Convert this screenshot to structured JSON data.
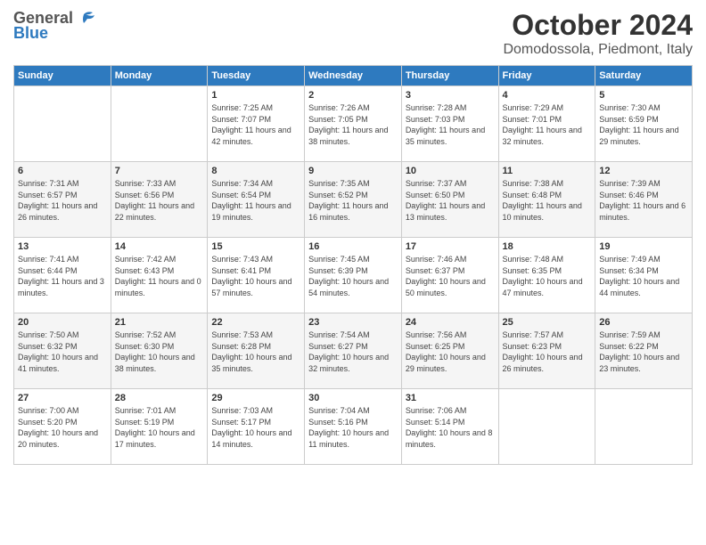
{
  "header": {
    "logo_general": "General",
    "logo_blue": "Blue",
    "month": "October 2024",
    "location": "Domodossola, Piedmont, Italy"
  },
  "weekdays": [
    "Sunday",
    "Monday",
    "Tuesday",
    "Wednesday",
    "Thursday",
    "Friday",
    "Saturday"
  ],
  "weeks": [
    [
      {
        "day": "",
        "info": ""
      },
      {
        "day": "",
        "info": ""
      },
      {
        "day": "1",
        "info": "Sunrise: 7:25 AM\nSunset: 7:07 PM\nDaylight: 11 hours and 42 minutes."
      },
      {
        "day": "2",
        "info": "Sunrise: 7:26 AM\nSunset: 7:05 PM\nDaylight: 11 hours and 38 minutes."
      },
      {
        "day": "3",
        "info": "Sunrise: 7:28 AM\nSunset: 7:03 PM\nDaylight: 11 hours and 35 minutes."
      },
      {
        "day": "4",
        "info": "Sunrise: 7:29 AM\nSunset: 7:01 PM\nDaylight: 11 hours and 32 minutes."
      },
      {
        "day": "5",
        "info": "Sunrise: 7:30 AM\nSunset: 6:59 PM\nDaylight: 11 hours and 29 minutes."
      }
    ],
    [
      {
        "day": "6",
        "info": "Sunrise: 7:31 AM\nSunset: 6:57 PM\nDaylight: 11 hours and 26 minutes."
      },
      {
        "day": "7",
        "info": "Sunrise: 7:33 AM\nSunset: 6:56 PM\nDaylight: 11 hours and 22 minutes."
      },
      {
        "day": "8",
        "info": "Sunrise: 7:34 AM\nSunset: 6:54 PM\nDaylight: 11 hours and 19 minutes."
      },
      {
        "day": "9",
        "info": "Sunrise: 7:35 AM\nSunset: 6:52 PM\nDaylight: 11 hours and 16 minutes."
      },
      {
        "day": "10",
        "info": "Sunrise: 7:37 AM\nSunset: 6:50 PM\nDaylight: 11 hours and 13 minutes."
      },
      {
        "day": "11",
        "info": "Sunrise: 7:38 AM\nSunset: 6:48 PM\nDaylight: 11 hours and 10 minutes."
      },
      {
        "day": "12",
        "info": "Sunrise: 7:39 AM\nSunset: 6:46 PM\nDaylight: 11 hours and 6 minutes."
      }
    ],
    [
      {
        "day": "13",
        "info": "Sunrise: 7:41 AM\nSunset: 6:44 PM\nDaylight: 11 hours and 3 minutes."
      },
      {
        "day": "14",
        "info": "Sunrise: 7:42 AM\nSunset: 6:43 PM\nDaylight: 11 hours and 0 minutes."
      },
      {
        "day": "15",
        "info": "Sunrise: 7:43 AM\nSunset: 6:41 PM\nDaylight: 10 hours and 57 minutes."
      },
      {
        "day": "16",
        "info": "Sunrise: 7:45 AM\nSunset: 6:39 PM\nDaylight: 10 hours and 54 minutes."
      },
      {
        "day": "17",
        "info": "Sunrise: 7:46 AM\nSunset: 6:37 PM\nDaylight: 10 hours and 50 minutes."
      },
      {
        "day": "18",
        "info": "Sunrise: 7:48 AM\nSunset: 6:35 PM\nDaylight: 10 hours and 47 minutes."
      },
      {
        "day": "19",
        "info": "Sunrise: 7:49 AM\nSunset: 6:34 PM\nDaylight: 10 hours and 44 minutes."
      }
    ],
    [
      {
        "day": "20",
        "info": "Sunrise: 7:50 AM\nSunset: 6:32 PM\nDaylight: 10 hours and 41 minutes."
      },
      {
        "day": "21",
        "info": "Sunrise: 7:52 AM\nSunset: 6:30 PM\nDaylight: 10 hours and 38 minutes."
      },
      {
        "day": "22",
        "info": "Sunrise: 7:53 AM\nSunset: 6:28 PM\nDaylight: 10 hours and 35 minutes."
      },
      {
        "day": "23",
        "info": "Sunrise: 7:54 AM\nSunset: 6:27 PM\nDaylight: 10 hours and 32 minutes."
      },
      {
        "day": "24",
        "info": "Sunrise: 7:56 AM\nSunset: 6:25 PM\nDaylight: 10 hours and 29 minutes."
      },
      {
        "day": "25",
        "info": "Sunrise: 7:57 AM\nSunset: 6:23 PM\nDaylight: 10 hours and 26 minutes."
      },
      {
        "day": "26",
        "info": "Sunrise: 7:59 AM\nSunset: 6:22 PM\nDaylight: 10 hours and 23 minutes."
      }
    ],
    [
      {
        "day": "27",
        "info": "Sunrise: 7:00 AM\nSunset: 5:20 PM\nDaylight: 10 hours and 20 minutes."
      },
      {
        "day": "28",
        "info": "Sunrise: 7:01 AM\nSunset: 5:19 PM\nDaylight: 10 hours and 17 minutes."
      },
      {
        "day": "29",
        "info": "Sunrise: 7:03 AM\nSunset: 5:17 PM\nDaylight: 10 hours and 14 minutes."
      },
      {
        "day": "30",
        "info": "Sunrise: 7:04 AM\nSunset: 5:16 PM\nDaylight: 10 hours and 11 minutes."
      },
      {
        "day": "31",
        "info": "Sunrise: 7:06 AM\nSunset: 5:14 PM\nDaylight: 10 hours and 8 minutes."
      },
      {
        "day": "",
        "info": ""
      },
      {
        "day": "",
        "info": ""
      }
    ]
  ]
}
